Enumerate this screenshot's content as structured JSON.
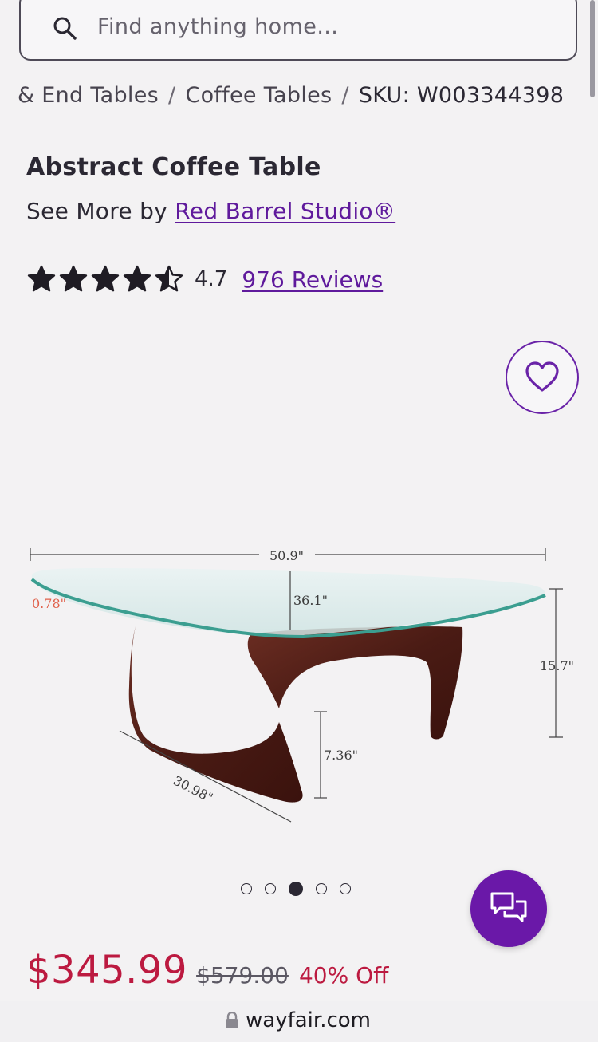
{
  "search": {
    "placeholder": "Find anything home..."
  },
  "breadcrumb": {
    "items": [
      "& End Tables",
      "Coffee Tables"
    ],
    "sku": "SKU: W003344398"
  },
  "product": {
    "title": "Abstract Coffee Table",
    "see_more_prefix": "See More by",
    "brand": "Red Barrel Studio®",
    "rating": "4.7",
    "rating_value": 4.5,
    "reviews": "976 Reviews"
  },
  "image": {
    "dims": {
      "width": "50.9\"",
      "depth": "36.1\"",
      "thickness": "0.78\"",
      "height": "15.7\"",
      "base_height": "7.36\"",
      "base_depth": "30.98\""
    },
    "carousel_count": 5,
    "carousel_active": 3
  },
  "pricing": {
    "price": "$345.99",
    "original": "$579.00",
    "discount": "40% Off"
  },
  "browser": {
    "url": "wayfair.com"
  },
  "colors": {
    "accent": "#5f1a9c",
    "sale": "#bc1a40"
  },
  "icons": [
    "search-icon",
    "heart-icon",
    "star-icon",
    "chat-icon",
    "lock-icon"
  ]
}
